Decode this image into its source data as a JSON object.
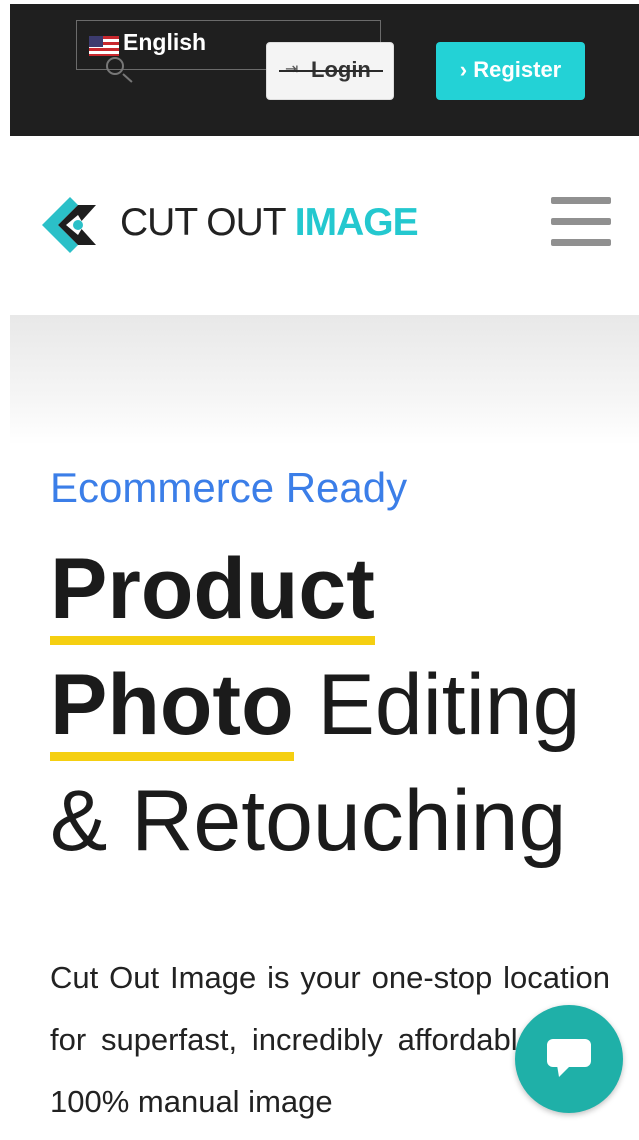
{
  "topbar": {
    "language": {
      "label": "English",
      "flag": "us-flag-icon"
    },
    "login_label": "Login",
    "register_label": "Register",
    "colors": {
      "background": "#1f1f1f",
      "register": "#23d2d6"
    }
  },
  "header": {
    "logo": {
      "text_dark": "CUT OUT ",
      "text_accent": "IMAGE",
      "accent_color": "#24c8cf"
    },
    "menu_icon": "hamburger-icon"
  },
  "hero": {
    "eyebrow": "Ecommerce Ready",
    "headline": {
      "line1_bold": "Product",
      "line2_bold": "Photo",
      "line2_rest": " Editing",
      "line3": "& Retouching"
    },
    "intro": "Cut Out Image is your one-stop location for superfast, incredibly affordable, and 100% manual image",
    "colors": {
      "eyebrow": "#3b7ee8",
      "underline": "#f5cf11"
    }
  },
  "chat": {
    "icon": "chat-bubble-icon",
    "color": "#1fb0a8"
  }
}
